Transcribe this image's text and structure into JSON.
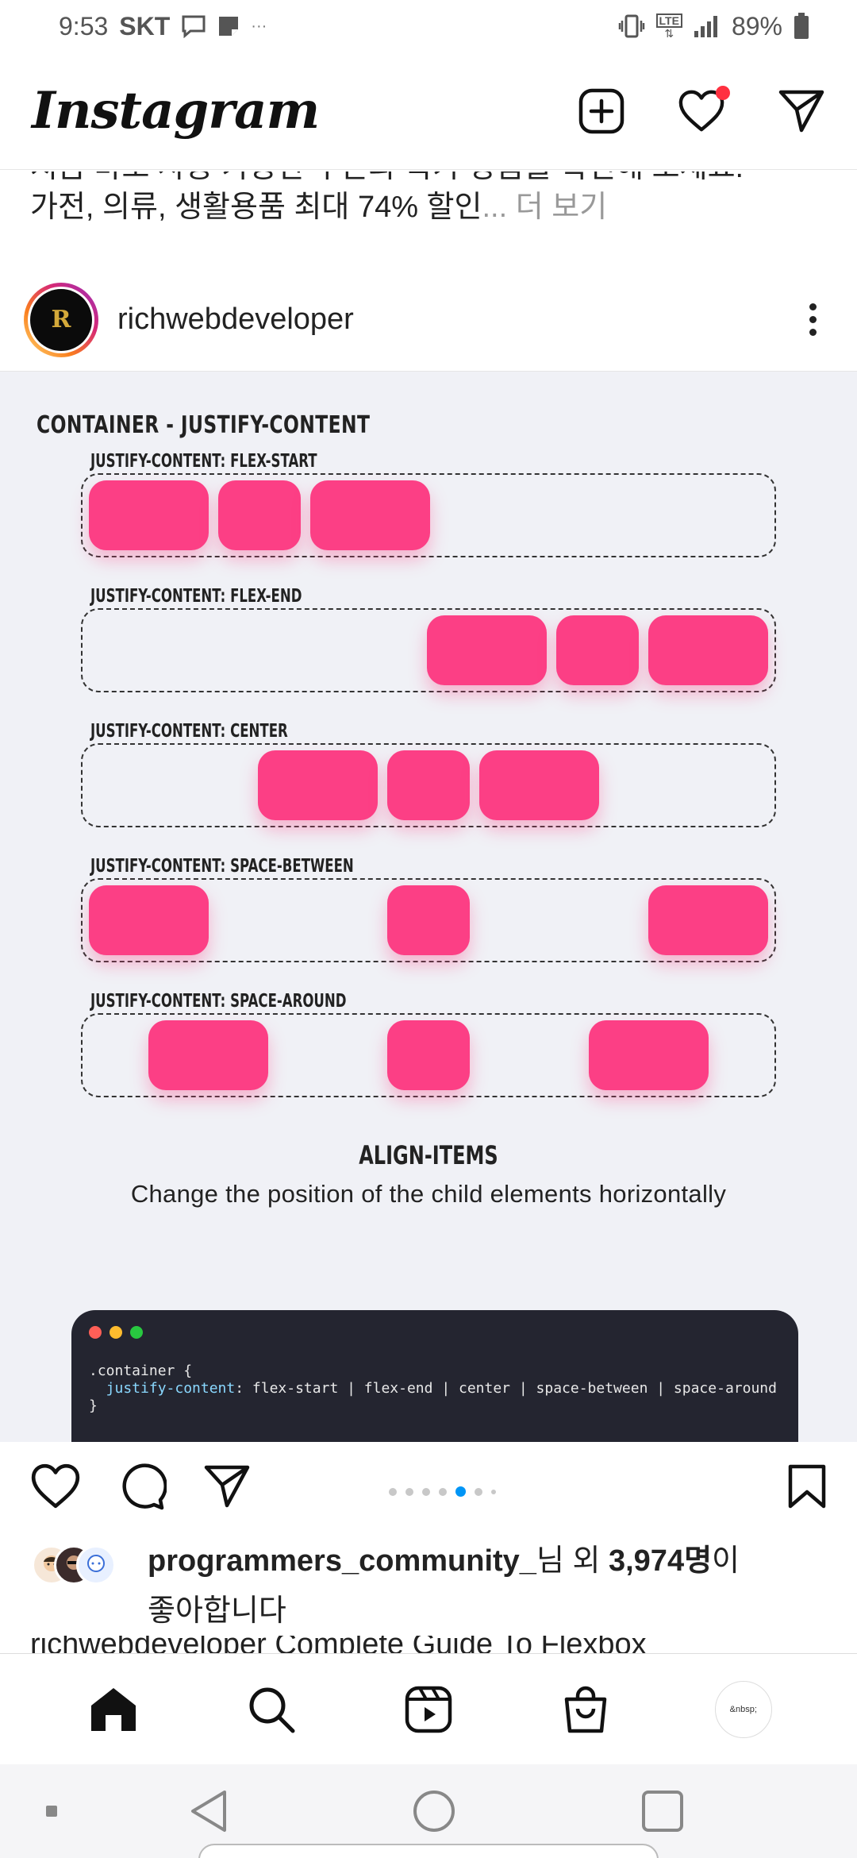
{
  "status_bar": {
    "time": "9:53",
    "carrier": "SKT",
    "more": "···",
    "battery": "89%",
    "network": "LTE"
  },
  "app_bar": {
    "logo": "Instagram",
    "icons": [
      "new-post-icon",
      "heart-icon",
      "direct-message-icon"
    ],
    "notification_dot_color": "#ff3040"
  },
  "previous_post": {
    "cut_line": "지금 바로 사용 가능한 쿠폰과 특가 상품을 확인해 보세요.",
    "caption_line": "가전, 의류, 생활용품 최대 74% 할인",
    "more_label": "... 더 보기"
  },
  "post": {
    "username": "richwebdeveloper",
    "avatar_letter": "R",
    "slide": {
      "title": "CONTAINER - JUSTIFY-CONTENT",
      "demos": [
        {
          "label": "JUSTIFY-CONTENT: FLEX-START"
        },
        {
          "label": "JUSTIFY-CONTENT: FLEX-END"
        },
        {
          "label": "JUSTIFY-CONTENT: CENTER"
        },
        {
          "label": "JUSTIFY-CONTENT: SPACE-BETWEEN"
        },
        {
          "label": "JUSTIFY-CONTENT: SPACE-AROUND"
        }
      ],
      "item_color": "#fc3f85",
      "section_heading": "ALIGN-ITEMS",
      "section_sub": "Change the position of the child elements horizontally",
      "code": {
        "line1": ".container {",
        "prop": "  justify-content",
        "value": ": flex-start | flex-end | center | space-between | space-around",
        "line3": "}",
        "dot_colors": [
          "#ff5f57",
          "#febc2e",
          "#28c840"
        ]
      }
    },
    "carousel": {
      "total": 7,
      "active_index": 4,
      "accent": "#0095f6"
    },
    "likes": {
      "user": "programmers_community_",
      "mid": "님 외 ",
      "count": "3,974명",
      "suffix": "이",
      "line2": "좋아합니다"
    },
    "caption_preview": "richwebdeveloper Complete Guide To Flexbox"
  },
  "bottom_nav": {
    "items": [
      "home-icon",
      "search-icon",
      "reels-icon",
      "shop-icon"
    ],
    "profile_text": "&nbsp;"
  },
  "system_nav": [
    "back-button",
    "home-button",
    "recents-button"
  ]
}
